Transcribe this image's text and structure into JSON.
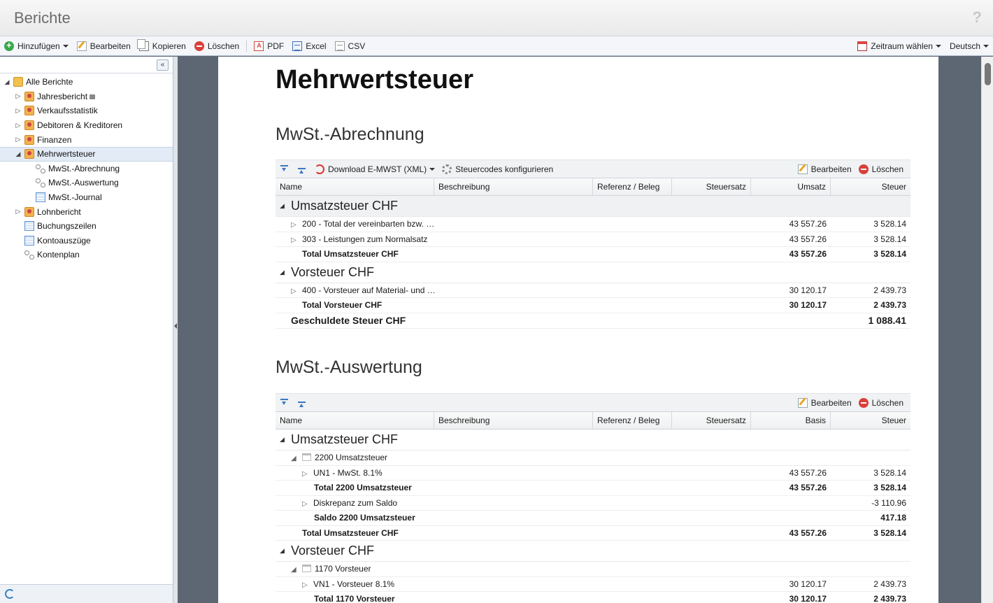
{
  "window": {
    "title": "Berichte",
    "help": "?"
  },
  "toolbar": {
    "add": "Hinzufügen",
    "edit": "Bearbeiten",
    "copy": "Kopieren",
    "delete": "Löschen",
    "pdf": "PDF",
    "excel": "Excel",
    "csv": "CSV",
    "period": "Zeitraum wählen",
    "language": "Deutsch"
  },
  "sidebar": {
    "collapse": "«",
    "root": "Alle Berichte",
    "items": [
      {
        "label": "Jahresbericht"
      },
      {
        "label": "Verkaufsstatistik"
      },
      {
        "label": "Debitoren & Kreditoren"
      },
      {
        "label": "Finanzen"
      },
      {
        "label": "Mehrwertsteuer"
      },
      {
        "label": "MwSt.-Abrechnung"
      },
      {
        "label": "MwSt.-Auswertung"
      },
      {
        "label": "MwSt.-Journal"
      },
      {
        "label": "Lohnbericht"
      },
      {
        "label": "Buchungszeilen"
      },
      {
        "label": "Kontoauszüge"
      },
      {
        "label": "Kontenplan"
      }
    ]
  },
  "document": {
    "title": "Mehrwertsteuer",
    "section1": {
      "title": "MwSt.-Abrechnung",
      "download": "Download E-MWST (XML)",
      "config": "Steuercodes konfigurieren",
      "edit": "Bearbeiten",
      "delete": "Löschen",
      "columns": [
        "Name",
        "Beschreibung",
        "Referenz / Beleg",
        "Steuersatz",
        "Umsatz",
        "Steuer"
      ],
      "group1": "Umsatzsteuer CHF",
      "rows1": [
        {
          "name": "200 - Total der vereinbarten bzw. …",
          "amount": "43 557.26",
          "tax": "3 528.14"
        },
        {
          "name": "303 - Leistungen zum Normalsatz",
          "amount": "43 557.26",
          "tax": "3 528.14"
        }
      ],
      "total1": {
        "name": "Total Umsatzsteuer CHF",
        "amount": "43 557.26",
        "tax": "3 528.14"
      },
      "group2": "Vorsteuer CHF",
      "rows2": [
        {
          "name": "400 - Vorsteuer auf Material- und …",
          "amount": "30 120.17",
          "tax": "2 439.73"
        }
      ],
      "total2": {
        "name": "Total Vorsteuer CHF",
        "amount": "30 120.17",
        "tax": "2 439.73"
      },
      "final": {
        "name": "Geschuldete Steuer CHF",
        "tax": "1 088.41"
      }
    },
    "section2": {
      "title": "MwSt.-Auswertung",
      "edit": "Bearbeiten",
      "delete": "Löschen",
      "columns": [
        "Name",
        "Beschreibung",
        "Referenz / Beleg",
        "Steuersatz",
        "Basis",
        "Steuer"
      ],
      "group1": "Umsatzsteuer CHF",
      "account1": "2200 Umsatzsteuer",
      "un1": {
        "name": "UN1 - MwSt. 8.1%",
        "basis": "43 557.26",
        "tax": "3 528.14"
      },
      "total_acc1": {
        "name": "Total 2200 Umsatzsteuer",
        "basis": "43 557.26",
        "tax": "3 528.14"
      },
      "diskrepanz": {
        "name": "Diskrepanz zum Saldo",
        "tax": "-3 110.96"
      },
      "saldo": {
        "name": "Saldo 2200 Umsatzsteuer",
        "tax": "417.18"
      },
      "total_group1": {
        "name": "Total Umsatzsteuer CHF",
        "basis": "43 557.26",
        "tax": "3 528.14"
      },
      "group2": "Vorsteuer CHF",
      "account2": "1170 Vorsteuer",
      "vn1": {
        "name": "VN1 - Vorsteuer 8.1%",
        "basis": "30 120.17",
        "tax": "2 439.73"
      },
      "total_acc2": {
        "name": "Total 1170 Vorsteuer",
        "basis": "30 120.17",
        "tax": "2 439.73"
      }
    }
  }
}
